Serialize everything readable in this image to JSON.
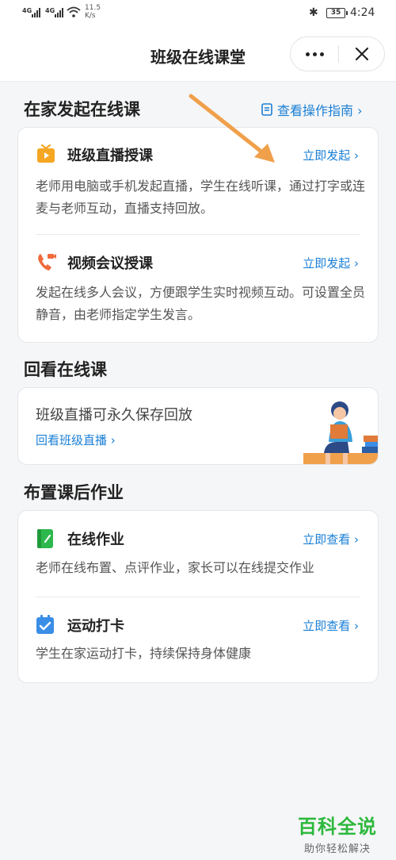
{
  "status_bar": {
    "signal1": "4G",
    "signal2": "4G",
    "speed_value": "11.5",
    "speed_unit": "K/s",
    "battery": "35",
    "time": "4:24"
  },
  "nav": {
    "title": "班级在线课堂"
  },
  "section_live": {
    "title": "在家发起在线课",
    "guide_link": "查看操作指南 ›",
    "items": [
      {
        "title": "班级直播授课",
        "action": "立即发起 ›",
        "description": "老师用电脑或手机发起直播，学生在线听课，通过打字或连麦与老师互动，直播支持回放。",
        "icon": "tv-icon",
        "color": "#f5a623"
      },
      {
        "title": "视频会议授课",
        "action": "立即发起 ›",
        "description": "发起在线多人会议，方便跟学生实时视频互动。可设置全员静音，由老师指定学生发言。",
        "icon": "phone-video-icon",
        "color": "#f06a3c"
      }
    ]
  },
  "section_replay": {
    "title": "回看在线课",
    "card_text": "班级直播可永久保存回放",
    "card_link": "回看班级直播 ›"
  },
  "section_homework": {
    "title": "布置课后作业",
    "items": [
      {
        "title": "在线作业",
        "action": "立即查看 ›",
        "description": "老师在线布置、点评作业，家长可以在线提交作业",
        "icon": "notebook-icon",
        "color": "#2db84d"
      },
      {
        "title": "运动打卡",
        "action": "立即查看 ›",
        "description": "学生在家运动打卡，持续保持身体健康",
        "icon": "calendar-check-icon",
        "color": "#3a8ee6"
      }
    ]
  },
  "watermark": {
    "main": "百科全说",
    "sub": "助你轻松解决"
  },
  "colors": {
    "link": "#1a7fd6",
    "annotation_arrow": "#f0a04b"
  }
}
